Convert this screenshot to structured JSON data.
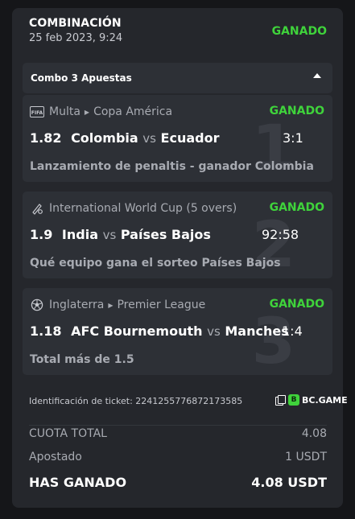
{
  "header": {
    "title": "COMBINACIÓN",
    "date": "25 feb 2023, 9:24",
    "status": "GANADO"
  },
  "combo": {
    "label": "Combo 3 Apuestas"
  },
  "bets": [
    {
      "number": "1",
      "league_icon": "fifa-icon",
      "league_icon_text": "FIFA",
      "league": "Multa",
      "competition": "Copa América",
      "status": "GANADO",
      "odds": "1.82",
      "home": "Colombia",
      "vs": "vs",
      "away": "Ecuador",
      "score": "3:1",
      "market": "Lanzamiento de penaltis - ganador Colombia"
    },
    {
      "number": "2",
      "league_icon": "cricket-icon",
      "league": "International World Cup (5 overs)",
      "competition": "",
      "status": "GANADO",
      "odds": "1.9",
      "home": "India",
      "vs": "vs",
      "away": "Países Bajos",
      "score": "92:58",
      "market": "Qué equipo gana el sorteo Países Bajos"
    },
    {
      "number": "3",
      "league_icon": "soccer-ball-icon",
      "league": "Inglaterra",
      "competition": "Premier League",
      "status": "GANADO",
      "odds": "1.18",
      "home": "AFC Bournemouth",
      "vs": "vs",
      "away": "Manches",
      "score": "1:4",
      "market": "Total más de 1.5"
    }
  ],
  "footer": {
    "ticket_label": "Identificación de ticket: 2241255776872173585",
    "brand": "BC.GAME",
    "brand_logo_text": "B",
    "total_odds_label": "CUOTA TOTAL",
    "total_odds_value": "4.08",
    "staked_label": "Apostado",
    "staked_value": "1 USDT",
    "won_label": "HAS GANADO",
    "won_value": "4.08 USDT"
  },
  "colors": {
    "win": "#3fd33b",
    "card": "#25272c",
    "panel": "#2d3036"
  }
}
